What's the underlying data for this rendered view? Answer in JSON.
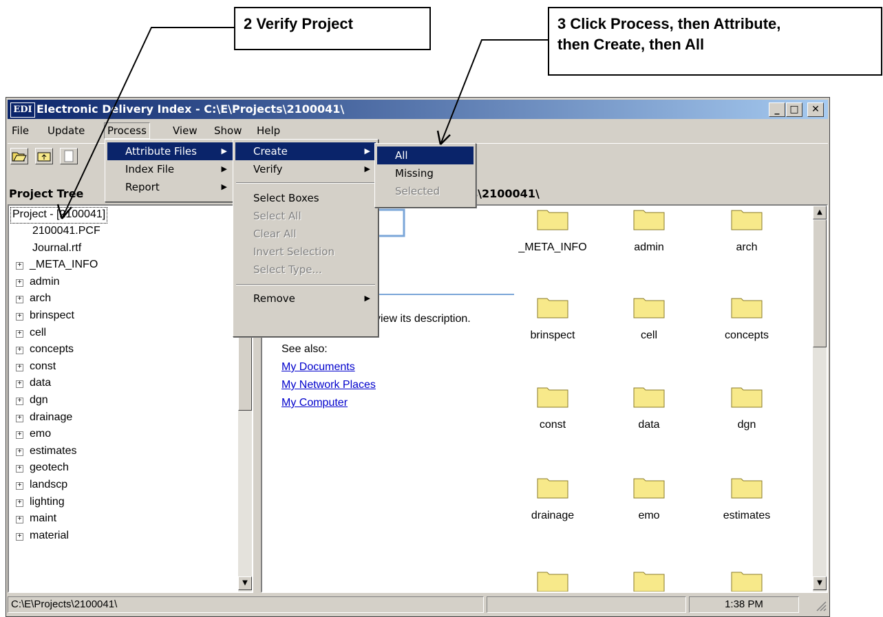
{
  "annotations": {
    "step2": "2 Verify Project",
    "step3_line1": "3 Click Process, then Attribute,",
    "step3_line2": "then Create, then All"
  },
  "window": {
    "logo": "EDI",
    "title": "Electronic Delivery Index - C:\\E\\Projects\\2100041\\",
    "min_glyph": "_",
    "max_glyph": "□",
    "close_glyph": "✕"
  },
  "menubar": [
    "File",
    "Update",
    "Process",
    "View",
    "Show",
    "Help"
  ],
  "panes": {
    "tree_label": "Project Tree",
    "right_label_fragment": "ts\\2100041\\"
  },
  "tree": {
    "root": "Project - [2100041]",
    "items": [
      "2100041.PCF",
      "Journal.rtf",
      "_META_INFO",
      "admin",
      "arch",
      "brinspect",
      "cell",
      "concepts",
      "const",
      "data",
      "dgn",
      "drainage",
      "emo",
      "estimates",
      "geotech",
      "landscp",
      "lighting",
      "maint",
      "material"
    ]
  },
  "info": {
    "description_fragment": "view its description.",
    "see_also": "See also:",
    "links": [
      "My Documents",
      "My Network Places",
      "My Computer"
    ]
  },
  "folders": [
    "_META_INFO",
    "admin",
    "arch",
    "brinspect",
    "cell",
    "concepts",
    "const",
    "data",
    "dgn",
    "drainage",
    "emo",
    "estimates"
  ],
  "menus": {
    "process": [
      "Attribute Files",
      "Index File",
      "Report"
    ],
    "attribute": {
      "create": "Create",
      "verify": "Verify",
      "select_boxes": "Select Boxes",
      "select_all": "Select All",
      "clear_all": "Clear All",
      "invert_selection": "Invert Selection",
      "select_type": "Select Type...",
      "remove": "Remove"
    },
    "create": {
      "all": "All",
      "missing": "Missing",
      "selected": "Selected"
    }
  },
  "status": {
    "path": "C:\\E\\Projects\\2100041\\",
    "middle": "",
    "time": "1:38 PM"
  },
  "colors": {
    "highlight": "#0a246a",
    "folder": "#f7e98a",
    "link": "#0000cc"
  },
  "icons": [
    "open-folder-icon",
    "up-folder-icon",
    "properties-icon",
    "folder-icon",
    "plus-expand-icon",
    "arrow-up-icon",
    "arrow-down-icon",
    "size-grip-icon"
  ]
}
